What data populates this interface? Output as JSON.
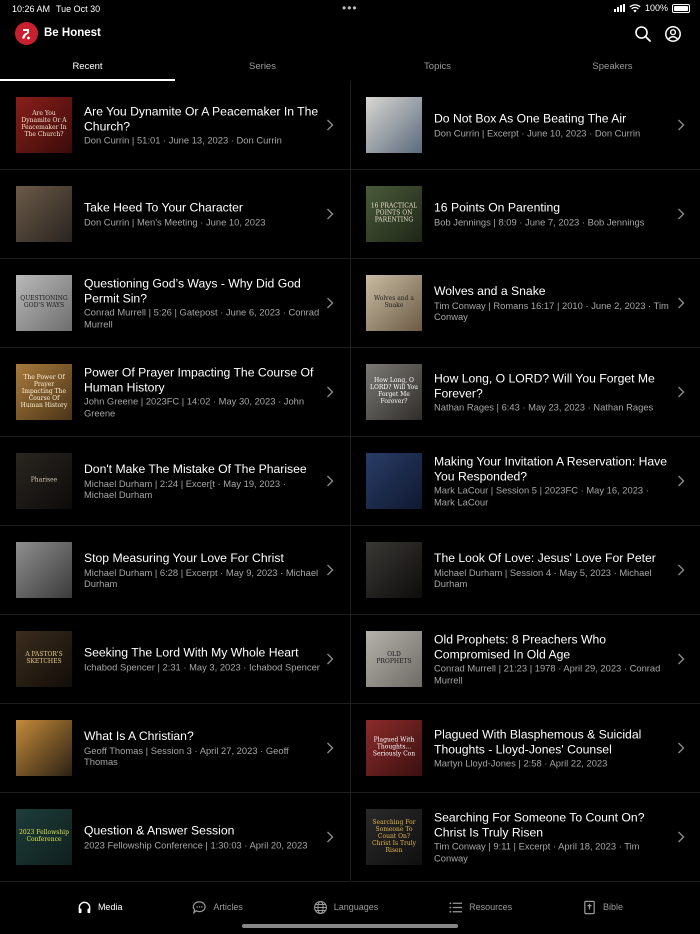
{
  "status": {
    "time": "10:26 AM",
    "date": "Tue Oct 30",
    "battery": "100%"
  },
  "app": {
    "title": "Be Honest"
  },
  "colors": {
    "brand": "#c8202f",
    "background": "#000000",
    "meta_text": "#a6a6a6"
  },
  "icons": {
    "header": [
      "search-icon",
      "account-icon"
    ],
    "chevron": "chevron-right-icon"
  },
  "tabs": [
    {
      "label": "Recent",
      "active": true
    },
    {
      "label": "Series",
      "active": false
    },
    {
      "label": "Topics",
      "active": false
    },
    {
      "label": "Speakers",
      "active": false
    }
  ],
  "sermons": {
    "left": [
      {
        "title": "Are You Dynamite Or A Peacemaker In The Church?",
        "meta": "Don Currin | 51:01 · June 13, 2023 · Don Currin",
        "thumb_text": "Are You Dynamite Or A Peacemaker In The Church?"
      },
      {
        "title": "Take Heed To Your Character",
        "meta": "Don Currin | Men's Meeting · June 10, 2023",
        "thumb_text": ""
      },
      {
        "title": "Questioning God’s Ways - Why Did God Permit Sin?",
        "meta": "Conrad Murrell | 5:26 | Gatepost · June 6, 2023 · Conrad Murrell",
        "thumb_text": "QUESTIONING GOD'S WAYS"
      },
      {
        "title": "Power Of Prayer Impacting The Course Of Human History",
        "meta": "John Greene | 2023FC | 14:02 · May 30, 2023 · John Greene",
        "thumb_text": "The Power Of Prayer Impacting The Course Of Human History"
      },
      {
        "title": "Don't Make The Mistake Of The Pharisee",
        "meta": "Michael Durham | 2:24 | Excer[t · May 19, 2023 · Michael Durham",
        "thumb_text": "Pharisee"
      },
      {
        "title": "Stop Measuring Your Love For Christ",
        "meta": "Michael Durham | 6:28 | Excerpt · May 9, 2023 · Michael Durham",
        "thumb_text": ""
      },
      {
        "title": "Seeking The Lord With My Whole Heart",
        "meta": "Ichabod Spencer | 2:31 · May 3, 2023 · Ichabod Spencer",
        "thumb_text": "A PASTOR'S SKETCHES"
      },
      {
        "title": "What Is A Christian?",
        "meta": "Geoff Thomas | Session 3 · April 27, 2023 · Geoff Thomas",
        "thumb_text": ""
      },
      {
        "title": "Question & Answer Session",
        "meta": "2023 Fellowship Conference | 1:30:03 · April 20, 2023",
        "thumb_text": "2023 Fellowship Conference"
      }
    ],
    "right": [
      {
        "title": "Do Not Box As One Beating The Air",
        "meta": "Don Currin | Excerpt · June 10, 2023 · Don Currin",
        "thumb_text": ""
      },
      {
        "title": "16 Points On Parenting",
        "meta": "Bob Jennings | 8:09 · June 7, 2023 · Bob Jennings",
        "thumb_text": "16 PRACTICAL POINTS ON PARENTING"
      },
      {
        "title": "Wolves and a Snake",
        "meta": "Tim Conway | Romans 16:17 | 2010 · June 2, 2023 · Tim Conway",
        "thumb_text": "Wolves and a Snake"
      },
      {
        "title": "How Long, O LORD? Will You Forget Me Forever?",
        "meta": "Nathan Rages | 6:43 · May 23, 2023 · Nathan Rages",
        "thumb_text": "How Long, O LORD? Will You Forget Me Forever?"
      },
      {
        "title": "Making Your Invitation A Reservation: Have You Responded?",
        "meta": "Mark LaCour | Session 5 | 2023FC · May 16, 2023 · Mark LaCour",
        "thumb_text": ""
      },
      {
        "title": "The Look Of Love: Jesus' Love For Peter",
        "meta": "Michael Durham | Session 4 · May 5, 2023 · Michael Durham",
        "thumb_text": ""
      },
      {
        "title": "Old Prophets: 8 Preachers Who Compromised In Old Age",
        "meta": "Conrad Murrell | 21:23 | 1978 · April 29, 2023 · Conrad Murrell",
        "thumb_text": "OLD PROPHETS"
      },
      {
        "title": "Plagued With Blasphemous & Suicidal Thoughts - Lloyd-Jones' Counsel",
        "meta": "Martyn Lloyd-Jones | 2:58 · April 22, 2023",
        "thumb_text": "Plagued With Thoughts... Seriously Con"
      },
      {
        "title": "Searching For Someone To Count On? Christ Is Truly Risen",
        "meta": "Tim Conway | 9:11 | Excerpt · April 18, 2023 · Tim Conway",
        "thumb_text": "Searching For Someone To Count On? Christ Is Truly Risen"
      }
    ]
  },
  "bottom_nav": [
    {
      "label": "Media",
      "icon": "headphones-icon",
      "active": true
    },
    {
      "label": "Articles",
      "icon": "chat-bubble-icon",
      "active": false
    },
    {
      "label": "Languages",
      "icon": "globe-icon",
      "active": false
    },
    {
      "label": "Resources",
      "icon": "list-icon",
      "active": false
    },
    {
      "label": "Bible",
      "icon": "bible-icon",
      "active": false
    }
  ]
}
